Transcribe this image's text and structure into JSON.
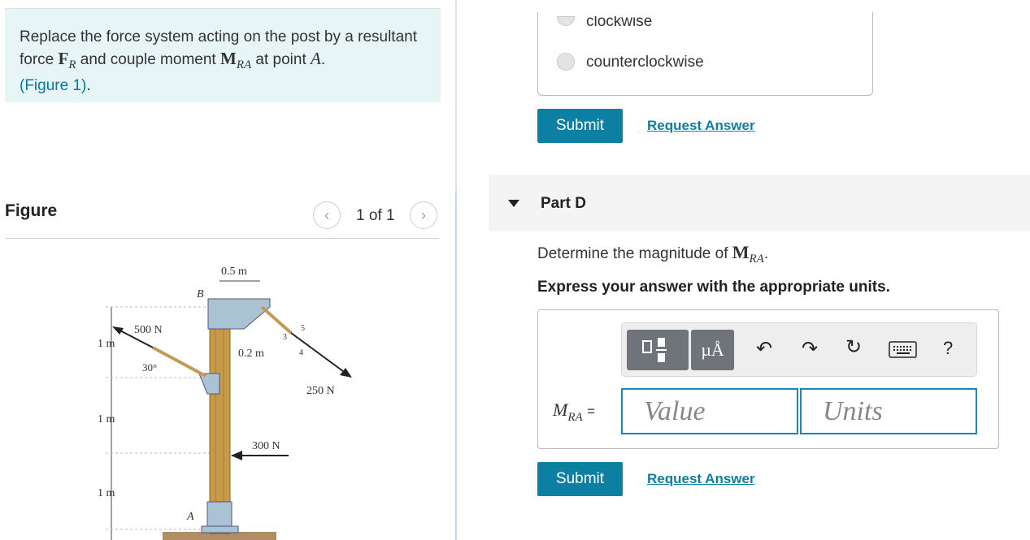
{
  "problem": {
    "text_before": "Replace the force system acting on the post by a resultant force ",
    "force_symbol": "F",
    "force_sub": "R",
    "text_middle": " and couple moment ",
    "moment_symbol": "M",
    "moment_sub": "RA",
    "text_after": " at point ",
    "point": "A",
    "text_end": ".",
    "figure_link": "(Figure 1)",
    "figure_link_end": "."
  },
  "figure": {
    "title": "Figure",
    "pager": "1 of 1",
    "prev_icon": "chevron-left-icon",
    "next_icon": "chevron-right-icon",
    "labels": {
      "dim_top": "0.5 m",
      "point_b": "B",
      "point_a": "A",
      "force_500": "500 N",
      "angle_30": "30°",
      "dim_02": "0.2 m",
      "slope_3": "3",
      "slope_4": "4",
      "slope_5": "5",
      "force_250": "250 N",
      "force_300": "300 N",
      "dim_1m_a": "1 m",
      "dim_1m_b": "1 m",
      "dim_1m_c": "1 m"
    }
  },
  "previous_part": {
    "choice_clockwise": "clockwise",
    "choice_counterclockwise": "counterclockwise",
    "submit": "Submit",
    "request_answer": "Request Answer"
  },
  "part_d": {
    "title": "Part D",
    "question_before": "Determine the magnitude of ",
    "moment_symbol": "M",
    "moment_sub": "RA",
    "question_after": ".",
    "instruction": "Express your answer with the appropriate units.",
    "toolbar": {
      "units_icon": "µÅ",
      "icons": [
        "template-icon",
        "units-icon",
        "undo-icon",
        "redo-icon",
        "reset-icon",
        "keyboard-icon",
        "help-icon"
      ],
      "help": "?"
    },
    "eq_symbol": "M",
    "eq_sub": "RA",
    "eq_sign": "=",
    "value_placeholder": "Value",
    "units_placeholder": "Units",
    "submit": "Submit",
    "request_answer": "Request Answer"
  }
}
